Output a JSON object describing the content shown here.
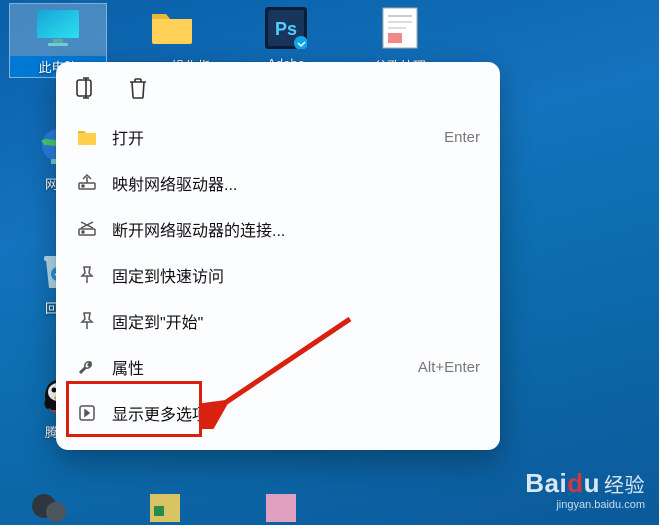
{
  "desktop": {
    "icons": [
      {
        "label": "此电脑",
        "selected": true,
        "type": "pc"
      },
      {
        "label": "SCRM操作指",
        "type": "folder"
      },
      {
        "label": "Adobe",
        "type": "ps"
      },
      {
        "label": "谷歌处理",
        "type": "doc"
      },
      {
        "label": "网络",
        "type": "net"
      },
      {
        "label": "回收",
        "type": "bin"
      },
      {
        "label": "腾讯",
        "type": "qq"
      }
    ]
  },
  "menu": {
    "top_icons": [
      "rename",
      "delete"
    ],
    "items": [
      {
        "icon": "folder",
        "label": "打开",
        "shortcut": "Enter"
      },
      {
        "icon": "map-drive",
        "label": "映射网络驱动器...",
        "shortcut": ""
      },
      {
        "icon": "disconnect",
        "label": "断开网络驱动器的连接...",
        "shortcut": ""
      },
      {
        "icon": "pin",
        "label": "固定到快速访问",
        "shortcut": ""
      },
      {
        "icon": "pin",
        "label": "固定到\"开始\"",
        "shortcut": ""
      },
      {
        "icon": "wrench",
        "label": "属性",
        "shortcut": "Alt+Enter"
      },
      {
        "icon": "more",
        "label": "显示更多选项",
        "shortcut": ""
      }
    ]
  },
  "watermark": {
    "brand_prefix": "Bai",
    "brand_mid": "d",
    "brand_suffix": "u",
    "brand_tail": "经验",
    "url": "jingyan.baidu.com"
  }
}
